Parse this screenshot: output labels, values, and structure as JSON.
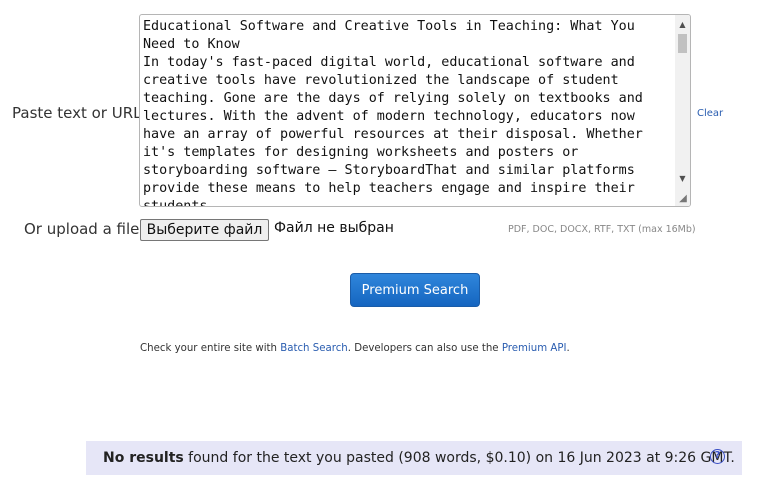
{
  "form": {
    "paste_label": "Paste text or URL:",
    "paste_value": "Educational Software and Creative Tools in Teaching: What You Need to Know\nIn today's fast-paced digital world, educational software and creative tools have revolutionized the landscape of student teaching. Gone are the days of relying solely on textbooks and lectures. With the advent of modern technology, educators now have an array of powerful resources at their disposal. Whether it's templates for designing worksheets and posters or storyboarding software – StoryboardThat and similar platforms provide these means to help teachers engage and inspire their students.",
    "clear_label": "Clear",
    "upload_label": "Or upload a file:",
    "file_button_label": "Выберите файл",
    "file_status": "Файл не выбран",
    "file_formats": "PDF, DOC, DOCX, RTF, TXT (max 16Mb)",
    "search_button_label": "Premium Search"
  },
  "info": {
    "prefix": "Check your entire site with ",
    "batch_link": "Batch Search",
    "middle": ". Developers can also use the ",
    "api_link": "Premium API",
    "suffix": "."
  },
  "result": {
    "bold": "No results",
    "text": " found for the text you pasted (908 words, $0.10) on 16 Jun 2023 at 9:26 GMT.",
    "help_icon": "question-circle-icon"
  },
  "colors": {
    "link": "#2a5db0",
    "button_primary": "#1b6fd0",
    "result_background": "#e6e6f7"
  }
}
